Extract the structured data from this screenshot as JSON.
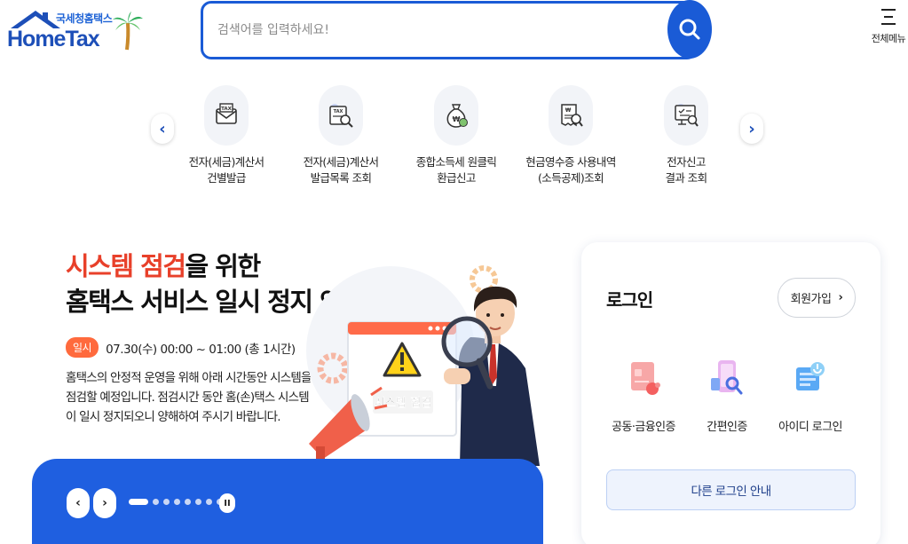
{
  "header": {
    "logo_small": "국세청홈택스",
    "logo_main": "HomeTax",
    "search_placeholder": "검색어를 입력하세요!",
    "menu_label": "전체메뉴"
  },
  "quick_menu": {
    "prev": "‹",
    "next": "›",
    "items": [
      {
        "label": "전자(세금)계산서\n건별발급",
        "icon": "tax-invoice-icon"
      },
      {
        "label": "전자(세금)계산서\n발급목록 조회",
        "icon": "invoice-search-icon"
      },
      {
        "label": "종합소득세 원클릭\n환급신고",
        "icon": "refund-money-bag-icon"
      },
      {
        "label": "현금영수증 사용내역\n(소득공제)조회",
        "icon": "receipt-search-icon"
      },
      {
        "label": "전자신고\n결과 조회",
        "icon": "report-result-icon"
      }
    ]
  },
  "banner": {
    "title_highlight": "시스템 점검",
    "title_rest": "을 위한",
    "title_line2": "홈택스 서비스 일시 정지 안내",
    "badge": "일시",
    "time": "07.30(수) 00:00 ~ 01:00 (총 1시간)",
    "description": "홈택스의 안정적 운영을 위해 아래 시간동안 시스템을 점검할 예정입니다. 점검시간 동안 홈(손)택스 시스템이 일시 정지되오니 양해하여 주시기 바랍니다.",
    "illustration_sign": "시스템 점검",
    "controls": {
      "prev": "‹",
      "next": "›",
      "pause": "II",
      "slide_count": 8,
      "active_slide": 0
    }
  },
  "login": {
    "title": "로그인",
    "join_label": "회원가입",
    "join_chevron": "›",
    "methods": [
      {
        "label": "공동·금융인증",
        "icon": "certificate-card-icon"
      },
      {
        "label": "간편인증",
        "icon": "phone-auth-icon"
      },
      {
        "label": "아이디 로그인",
        "icon": "id-login-icon"
      }
    ],
    "other_login_label": "다른 로그인 안내"
  },
  "colors": {
    "brand_blue": "#1a5bd6",
    "highlight_red": "#e8402a",
    "badge_orange": "#ff6a3d",
    "control_bar_blue": "#1f5fe0"
  }
}
